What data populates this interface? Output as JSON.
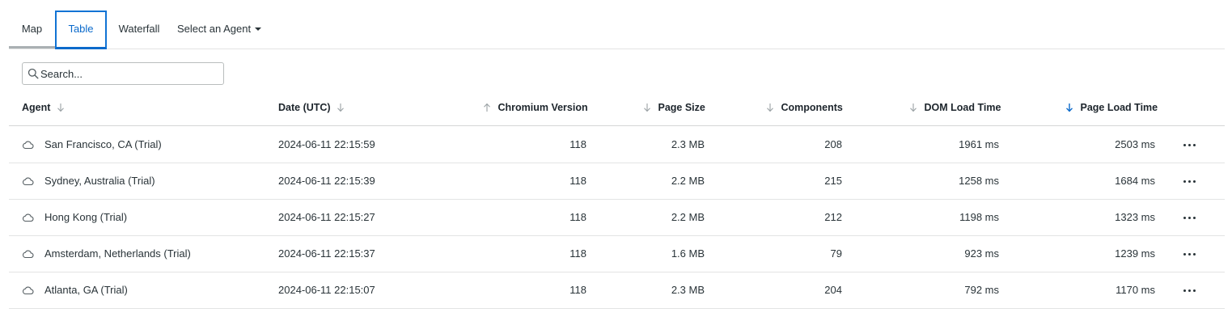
{
  "tabs": [
    {
      "label": "Map"
    },
    {
      "label": "Table"
    },
    {
      "label": "Waterfall"
    },
    {
      "label": "Select an Agent"
    }
  ],
  "active_tab": "Table",
  "search": {
    "placeholder": "Search...",
    "value": ""
  },
  "columns": [
    {
      "label": "Agent",
      "sort": "none"
    },
    {
      "label": "Date (UTC)",
      "sort": "none"
    },
    {
      "label": "Chromium Version",
      "sort": "none"
    },
    {
      "label": "Page Size",
      "sort": "none"
    },
    {
      "label": "Components",
      "sort": "none"
    },
    {
      "label": "DOM Load Time",
      "sort": "none"
    },
    {
      "label": "Page Load Time",
      "sort": "descending"
    }
  ],
  "rows": [
    {
      "agent": "San Francisco, CA (Trial)",
      "date": "2024-06-11 22:15:59",
      "chromium": "118",
      "page_size": "2.3 MB",
      "components": "208",
      "dom_load": "1961 ms",
      "page_load": "2503 ms"
    },
    {
      "agent": "Sydney, Australia (Trial)",
      "date": "2024-06-11 22:15:39",
      "chromium": "118",
      "page_size": "2.2 MB",
      "components": "215",
      "dom_load": "1258 ms",
      "page_load": "1684 ms"
    },
    {
      "agent": "Hong Kong (Trial)",
      "date": "2024-06-11 22:15:27",
      "chromium": "118",
      "page_size": "2.2 MB",
      "components": "212",
      "dom_load": "1198 ms",
      "page_load": "1323 ms"
    },
    {
      "agent": "Amsterdam, Netherlands (Trial)",
      "date": "2024-06-11 22:15:37",
      "chromium": "118",
      "page_size": "1.6 MB",
      "components": "79",
      "dom_load": "923 ms",
      "page_load": "1239 ms"
    },
    {
      "agent": "Atlanta, GA (Trial)",
      "date": "2024-06-11 22:15:07",
      "chromium": "118",
      "page_size": "2.3 MB",
      "components": "204",
      "dom_load": "792 ms",
      "page_load": "1170 ms"
    }
  ],
  "colors": {
    "accent": "#0b6acb",
    "text": "#293338",
    "border": "#e3e4e4",
    "arrow_inactive": "#9aa1a4"
  },
  "icons": {
    "agent_row": "cloud-icon",
    "row_action": "more-horizontal-icon",
    "search": "search-icon"
  }
}
